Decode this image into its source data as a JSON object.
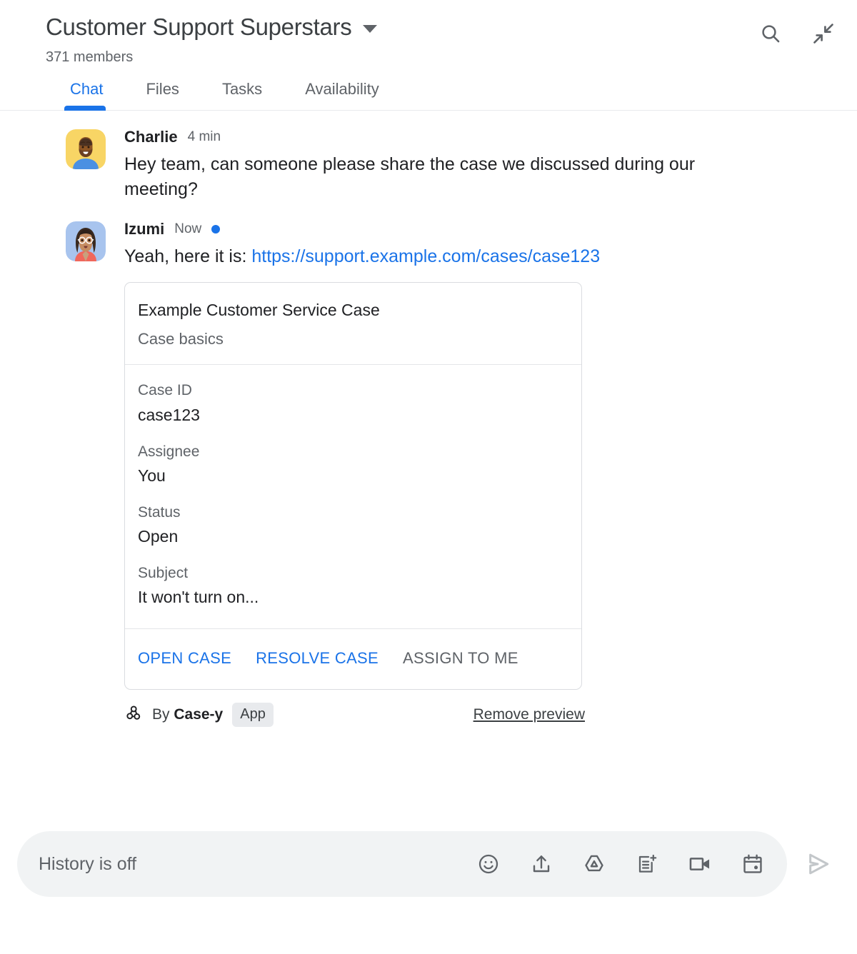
{
  "header": {
    "space_title": "Customer Support Superstars",
    "member_count": "371 members",
    "dropdown_icon": "chevron-down-icon",
    "actions": [
      {
        "name": "search-icon",
        "label": "Search"
      },
      {
        "name": "collapse-icon",
        "label": "Collapse"
      }
    ]
  },
  "tabs": [
    {
      "label": "Chat",
      "active": true
    },
    {
      "label": "Files",
      "active": false
    },
    {
      "label": "Tasks",
      "active": false
    },
    {
      "label": "Availability",
      "active": false
    }
  ],
  "messages": [
    {
      "author": "Charlie",
      "time": "4 min",
      "unread": false,
      "text": "Hey team, can someone please share the case we discussed during our meeting?"
    },
    {
      "author": "Izumi",
      "time": "Now",
      "unread": true,
      "text_prefix": "Yeah, here it is: ",
      "link_text": "https://support.example.com/cases/case123"
    }
  ],
  "card": {
    "title": "Example Customer Service Case",
    "subtitle": "Case basics",
    "fields": [
      {
        "label": "Case ID",
        "value": "case123"
      },
      {
        "label": "Assignee",
        "value": "You"
      },
      {
        "label": "Status",
        "value": "Open"
      },
      {
        "label": "Subject",
        "value": "It won't turn on..."
      }
    ],
    "actions": [
      {
        "label": "OPEN CASE",
        "style": "link"
      },
      {
        "label": "RESOLVE CASE",
        "style": "link"
      },
      {
        "label": "ASSIGN TO ME",
        "style": "muted"
      }
    ],
    "footer": {
      "app_icon": "webhook-bot-icon",
      "by_prefix": "By ",
      "app_name": "Case-y",
      "badge": "App",
      "remove_label": "Remove preview"
    }
  },
  "composer": {
    "placeholder": "History is off",
    "value": "",
    "tools": [
      {
        "name": "emoji-icon",
        "label": "Insert emoji"
      },
      {
        "name": "upload-icon",
        "label": "Upload file"
      },
      {
        "name": "google-drive-icon",
        "label": "Add from Drive"
      },
      {
        "name": "new-document-icon",
        "label": "Create new document"
      },
      {
        "name": "video-camera-icon",
        "label": "Start a video meeting"
      },
      {
        "name": "calendar-icon",
        "label": "Create an event"
      }
    ],
    "send_icon": "send-icon"
  },
  "colors": {
    "accent_blue": "#1a73e8",
    "text_primary": "#202124",
    "text_secondary": "#5f6368",
    "border": "#dadce0",
    "composer_bg": "#f1f3f4",
    "badge_bg": "#e8eaed"
  }
}
